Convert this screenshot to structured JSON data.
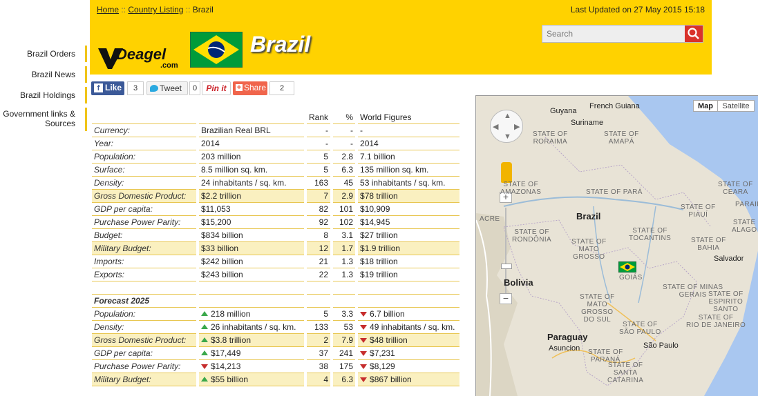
{
  "breadcrumb": {
    "home": "Home",
    "sep1": "::",
    "listing": "Country Listing",
    "sep2": "::",
    "current": "Brazil"
  },
  "last_updated": "Last Updated on 27 May 2015 15:18",
  "logo": {
    "name": "Deagel",
    "tld": ".com"
  },
  "country_title": "Brazil",
  "search": {
    "placeholder": "Search"
  },
  "sidebar": {
    "items": [
      {
        "label": "Brazil Orders"
      },
      {
        "label": "Brazil News"
      },
      {
        "label": "Brazil Holdings"
      },
      {
        "label": "Government links &",
        "label2": "Sources"
      }
    ]
  },
  "social": {
    "like_label": "Like",
    "like_count": "3",
    "tweet_label": "Tweet",
    "tweet_count": "0",
    "pin_label": "Pin it",
    "share_label": "Share",
    "share_count": "2"
  },
  "table": {
    "headers": {
      "rank": "Rank",
      "pct": "%",
      "world": "World Figures"
    },
    "rows": [
      {
        "label": "Currency:",
        "value": "Brazilian Real BRL",
        "rank": "-",
        "pct": "-",
        "world": "-",
        "hl": false
      },
      {
        "label": "Year:",
        "value": "2014",
        "rank": "-",
        "pct": "-",
        "world": "2014",
        "hl": false
      },
      {
        "label": "Population:",
        "value": "203 million",
        "rank": "5",
        "pct": "2.8",
        "world": "7.1 billion",
        "hl": false
      },
      {
        "label": "Surface:",
        "value": "8.5 million sq. km.",
        "rank": "5",
        "pct": "6.3",
        "world": "135 million sq. km.",
        "hl": false
      },
      {
        "label": "Density:",
        "value": "24 inhabitants / sq. km.",
        "rank": "163",
        "pct": "45",
        "world": "53 inhabitants / sq. km.",
        "hl": false
      },
      {
        "label": "Gross Domestic Product:",
        "value": "$2.2 trillion",
        "rank": "7",
        "pct": "2.9",
        "world": "$78 trillion",
        "hl": true
      },
      {
        "label": "GDP per capita:",
        "value": "$11,053",
        "rank": "82",
        "pct": "101",
        "world": "$10,909",
        "hl": false
      },
      {
        "label": "Purchase Power Parity:",
        "value": "$15,200",
        "rank": "92",
        "pct": "102",
        "world": "$14,945",
        "hl": false
      },
      {
        "label": "Budget:",
        "value": "$834 billion",
        "rank": "8",
        "pct": "3.1",
        "world": "$27 trillion",
        "hl": false
      },
      {
        "label": "Military Budget:",
        "value": "$33 billion",
        "rank": "12",
        "pct": "1.7",
        "world": "$1.9 trillion",
        "hl": true
      },
      {
        "label": "Imports:",
        "value": "$242 billion",
        "rank": "21",
        "pct": "1.3",
        "world": "$18 trillion",
        "hl": false
      },
      {
        "label": "Exports:",
        "value": "$243 billion",
        "rank": "22",
        "pct": "1.3",
        "world": "$19 trillion",
        "hl": false
      }
    ],
    "forecast_title": "Forecast 2025",
    "forecast": [
      {
        "label": "Population:",
        "value": "218 million",
        "dir": "up",
        "rank": "5",
        "pct": "3.3",
        "world": "6.7 billion",
        "wdir": "down",
        "hl": false
      },
      {
        "label": "Density:",
        "value": "26 inhabitants / sq. km.",
        "dir": "up",
        "rank": "133",
        "pct": "53",
        "world": "49 inhabitants / sq. km.",
        "wdir": "down",
        "hl": false
      },
      {
        "label": "Gross Domestic Product:",
        "value": "$3.8 trillion",
        "dir": "up",
        "rank": "2",
        "pct": "7.9",
        "world": "$48 trillion",
        "wdir": "down",
        "hl": true
      },
      {
        "label": "GDP per capita:",
        "value": "$17,449",
        "dir": "up",
        "rank": "37",
        "pct": "241",
        "world": "$7,231",
        "wdir": "down",
        "hl": false
      },
      {
        "label": "Purchase Power Parity:",
        "value": "$14,213",
        "dir": "down",
        "rank": "38",
        "pct": "175",
        "world": "$8,129",
        "wdir": "down",
        "hl": false
      },
      {
        "label": "Military Budget:",
        "value": "$55 billion",
        "dir": "up",
        "rank": "4",
        "pct": "6.3",
        "world": "$867 billion",
        "wdir": "down",
        "hl": true
      }
    ]
  },
  "map": {
    "type_map": "Map",
    "type_satellite": "Satellite",
    "zoom_in": "+",
    "zoom_out": "−",
    "countries": {
      "guyana": "Guyana",
      "french_guiana": "French Guiana",
      "suriname": "Suriname",
      "brazil": "Brazil",
      "bolivia": "Bolivia",
      "paraguay": "Paraguay"
    },
    "cities": {
      "salvador": "Salvador",
      "sao_paulo": "São Paulo",
      "asuncion": "Asuncion"
    },
    "states": {
      "roraima": [
        "STATE OF",
        "RORAIMA"
      ],
      "amapa": [
        "STATE OF",
        "AMAPÁ"
      ],
      "amazonas": [
        "STATE OF",
        "AMAZONAS"
      ],
      "para": "STATE OF PARÁ",
      "ceara": [
        "STATE OF",
        "CEARA"
      ],
      "paraiba": "PARAIBA",
      "piaui": [
        "STATE OF",
        "PIAUÍ"
      ],
      "alagoas": [
        "STATE",
        "ALAGO"
      ],
      "acre": "ACRE",
      "rondonia": [
        "STATE OF",
        "RONDÔNIA"
      ],
      "tocantins": [
        "STATE OF",
        "TOCANTINS"
      ],
      "bahia": [
        "STATE OF",
        "BAHIA"
      ],
      "mato_grosso": [
        "STATE OF",
        "MATO",
        "GROSSO"
      ],
      "goias": "GOIÁS",
      "minas": [
        "STATE OF MINAS",
        "GERAIS"
      ],
      "espirito": [
        "STATE OF",
        "ESPIRITO",
        "SANTO"
      ],
      "ms": [
        "STATE OF",
        "MATO",
        "GROSSO",
        "DO SUL"
      ],
      "rio": [
        "STATE OF",
        "RIO DE JANEIRO"
      ],
      "sp": [
        "STATE OF",
        "SÃO PAULO"
      ],
      "parana": [
        "STATE OF",
        "PARANÁ"
      ],
      "sc": [
        "STATE OF",
        "SANTA",
        "CATARINA"
      ]
    }
  },
  "colors": {
    "header_yellow": "#ffd200",
    "highlight_row": "#faf0c0",
    "up_green": "#3aa84a",
    "down_red": "#c62d2d"
  }
}
